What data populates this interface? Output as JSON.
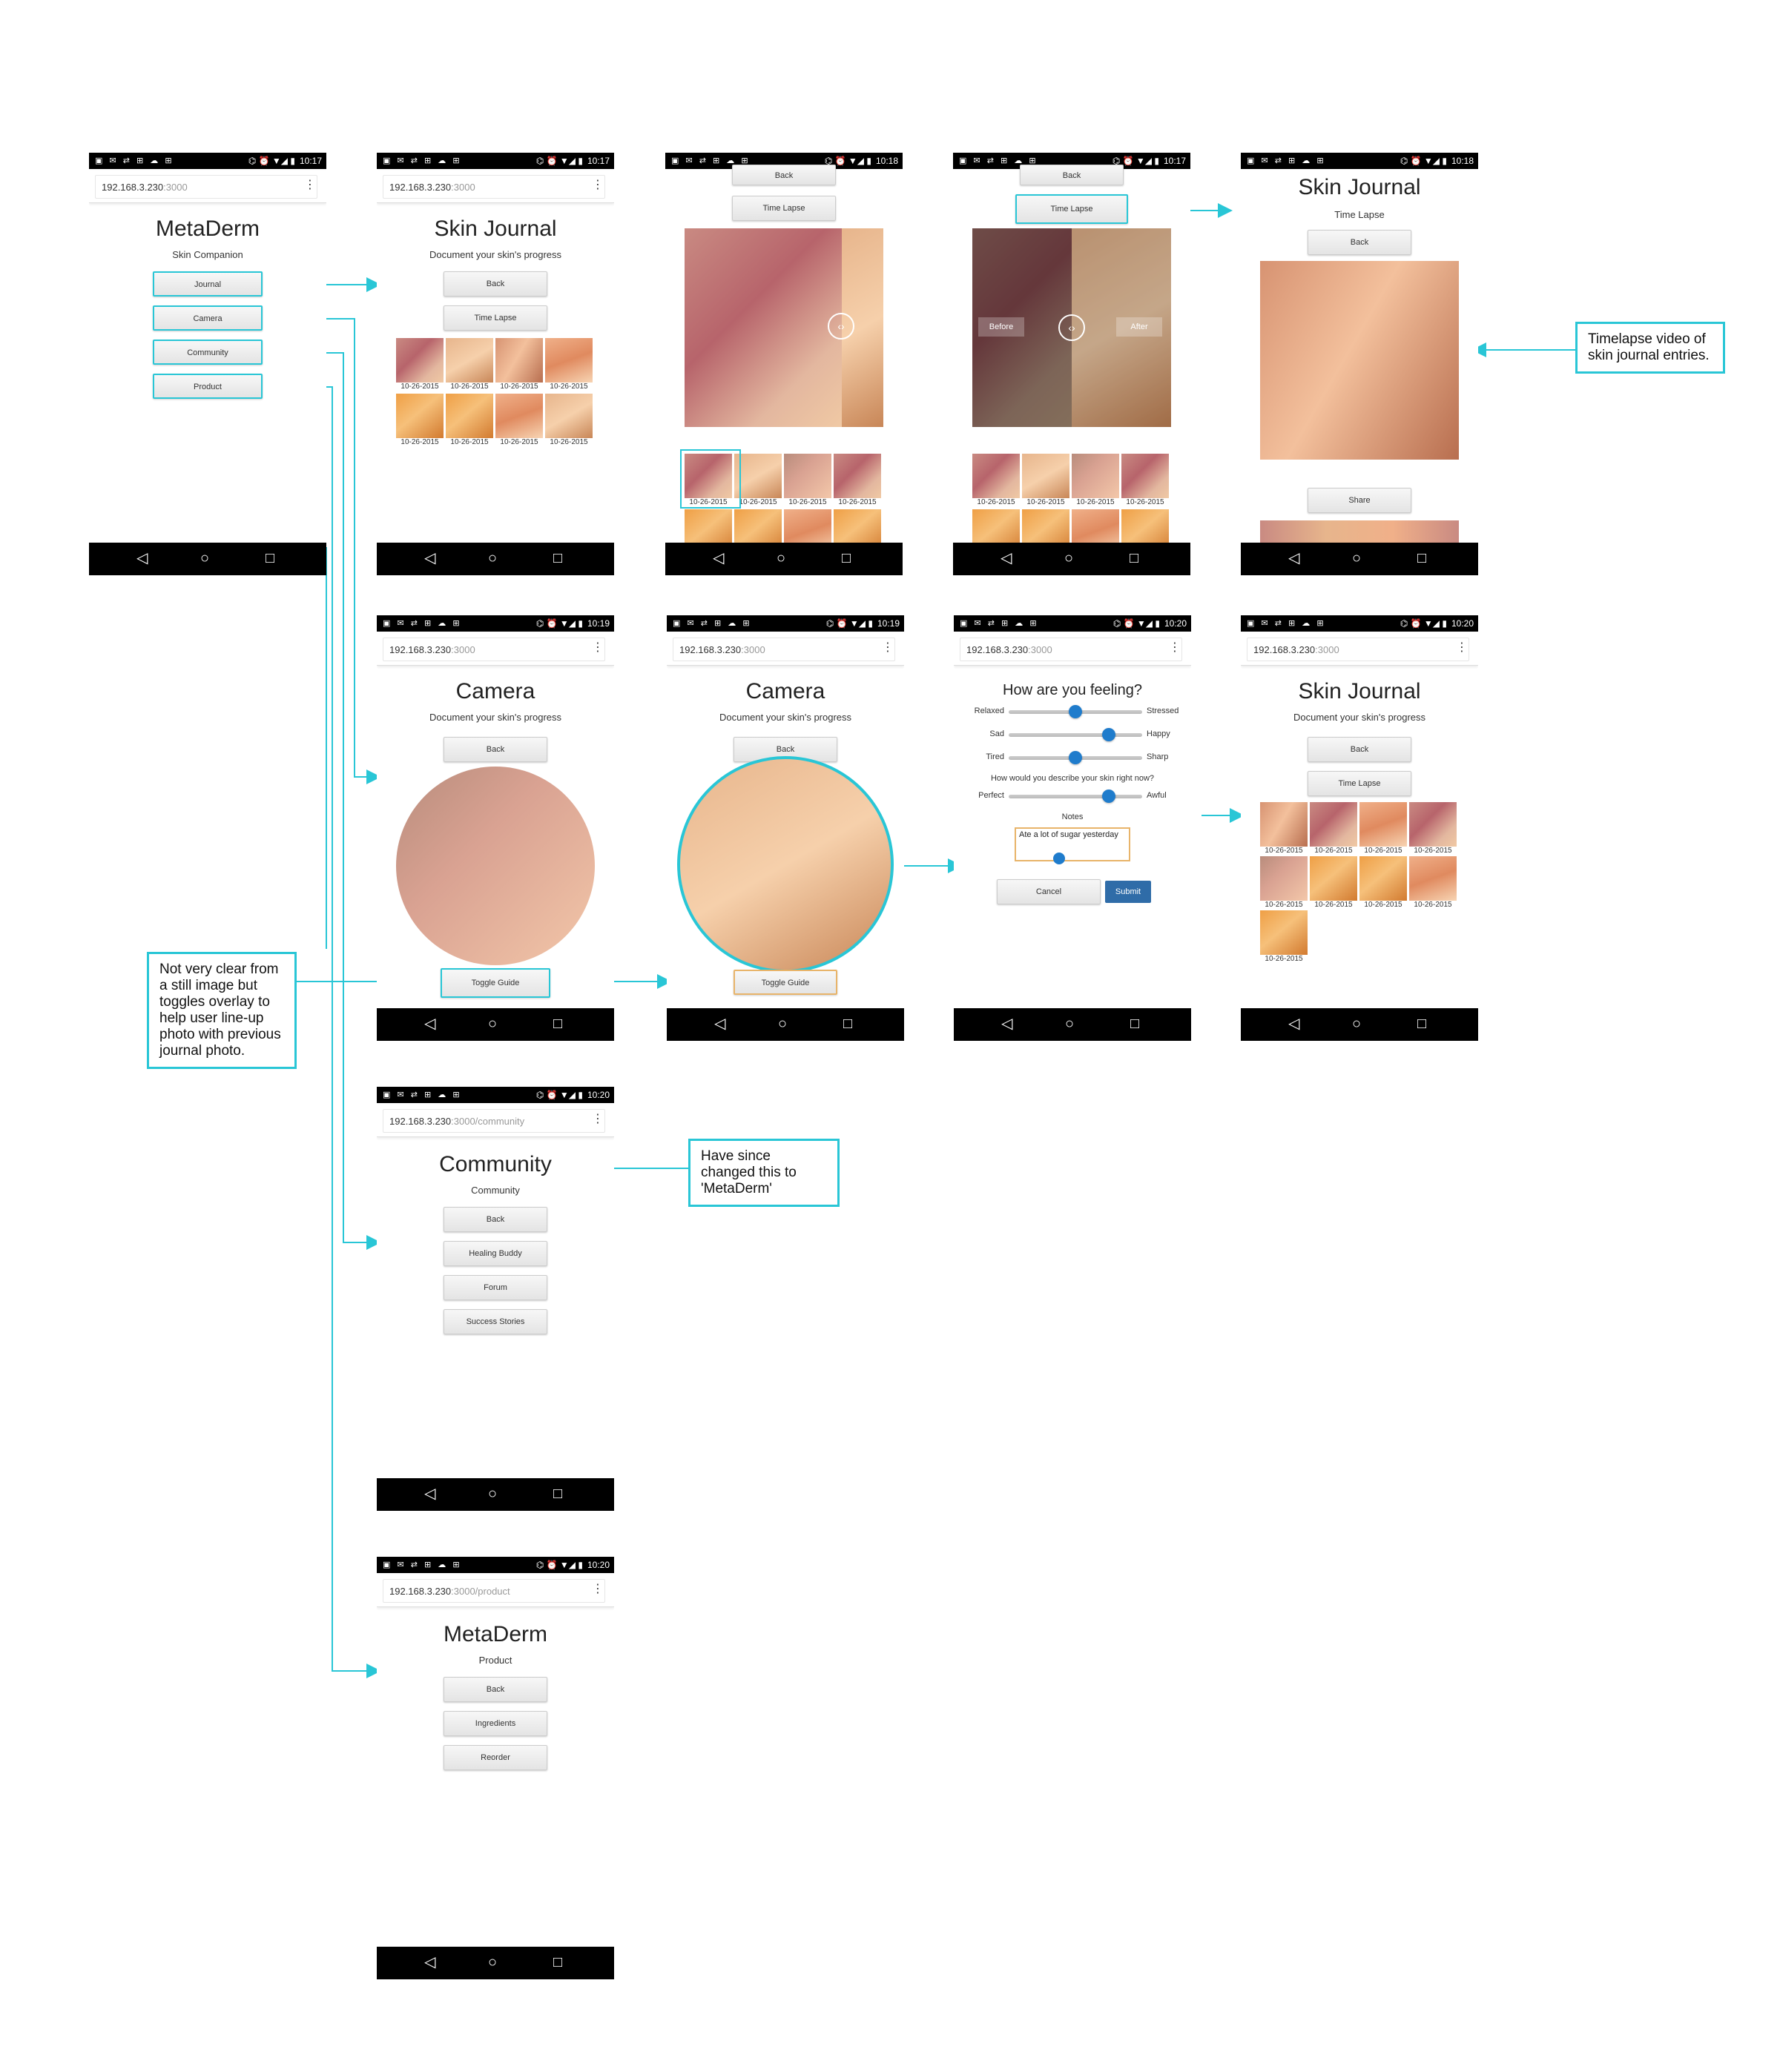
{
  "status": {
    "icons_left": "▣ ✉ ⇄ ⊞ ☁ ⊞",
    "icons_right": "⌬ ⏰ ▼◢ ▮"
  },
  "url": {
    "host": "192.168.3.230",
    "suffix": ":3000",
    "community_suffix": ":3000/community",
    "product_suffix": ":3000/product"
  },
  "phones": {
    "home": {
      "time": "10:17",
      "title": "MetaDerm",
      "subtitle": "Skin Companion",
      "buttons": [
        "Journal",
        "Camera",
        "Community",
        "Product"
      ]
    },
    "journal": {
      "time": "10:17",
      "title": "Skin Journal",
      "subtitle": "Document your skin's progress",
      "back": "Back",
      "timelapse": "Time Lapse"
    },
    "compare": {
      "time": "10:18",
      "back": "Back",
      "timelapse": "Time Lapse"
    },
    "compare2": {
      "time": "10:17",
      "back": "Back",
      "timelapse": "Time Lapse",
      "before": "Before",
      "after": "After"
    },
    "timelapse": {
      "time": "10:18",
      "title": "Skin Journal",
      "subtitle": "Time Lapse",
      "back": "Back",
      "share": "Share"
    },
    "camera": {
      "time": "10:19",
      "title": "Camera",
      "subtitle": "Document your skin's progress",
      "back": "Back",
      "toggle": "Toggle Guide"
    },
    "camera2": {
      "time": "10:19",
      "title": "Camera",
      "subtitle": "Document your skin's progress",
      "back": "Back",
      "toggle": "Toggle Guide"
    },
    "feeling": {
      "time": "10:20",
      "title": "How are you feeling?",
      "sliders": [
        {
          "left": "Relaxed",
          "right": "Stressed",
          "value": 0.5
        },
        {
          "left": "Sad",
          "right": "Happy",
          "value": 0.75
        },
        {
          "left": "Tired",
          "right": "Sharp",
          "value": 0.5
        }
      ],
      "question": "How would you describe your skin right now?",
      "skin_slider": {
        "left": "Perfect",
        "right": "Awful",
        "value": 0.75
      },
      "notes_label": "Notes",
      "notes_value": "Ate a lot of sugar yesterday",
      "cancel": "Cancel",
      "submit": "Submit"
    },
    "journal2": {
      "time": "10:20",
      "title": "Skin Journal",
      "subtitle": "Document your skin's progress",
      "back": "Back",
      "timelapse": "Time Lapse"
    },
    "community": {
      "time": "10:20",
      "title": "Community",
      "subtitle": "Community",
      "buttons": [
        "Back",
        "Healing Buddy",
        "Forum",
        "Success Stories"
      ]
    },
    "product": {
      "time": "10:20",
      "title": "MetaDerm",
      "subtitle": "Product",
      "buttons": [
        "Back",
        "Ingredients",
        "Reorder"
      ]
    }
  },
  "thumb_date": "10-26-2015",
  "annotations": {
    "timelapse": "Timelapse video of skin journal entries.",
    "guide": "Not very clear from a still image but toggles overlay to help user line-up photo with previous journal photo.",
    "community": "Have since changed this to 'MetaDerm'"
  },
  "colors": {
    "accent": "#29c6d6",
    "submit": "#2f6ca8",
    "knob": "#1f7ccc"
  }
}
